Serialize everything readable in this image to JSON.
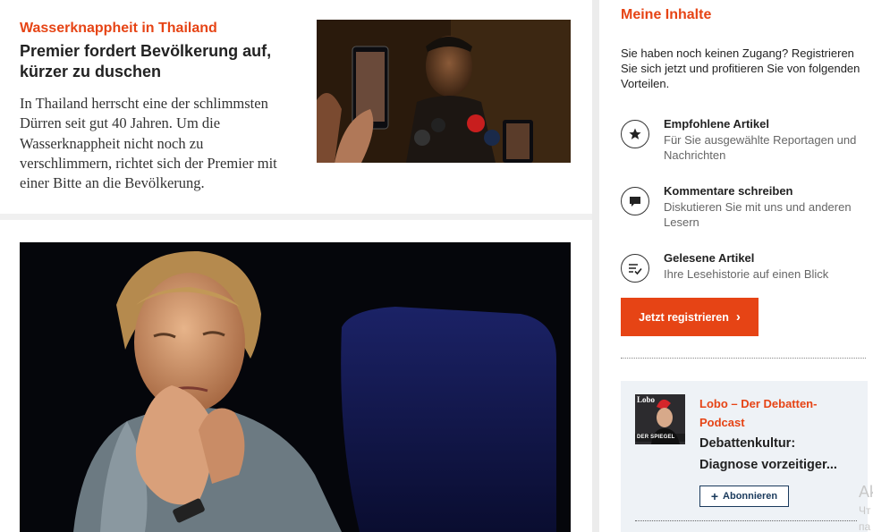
{
  "article1": {
    "kicker": "Wasserknappheit in Thailand",
    "headline": "Premier fordert Bevölkerung auf, kürzer zu duschen",
    "teaser": "In Thailand herrscht eine der schlimmsten Dürren seit gut 40 Jahren. Um die Wasserknappheit nicht noch zu verschlimmern, richtet sich der Premier mit einer Bitte an die Bevölkerung."
  },
  "sidebar": {
    "title": "Meine Inhalte",
    "intro": "Sie haben noch keinen Zugang? Registrieren Sie sich jetzt und profitieren Sie von folgenden Vorteilen.",
    "benefits": [
      {
        "icon": "star-icon",
        "title": "Empfohlene Artikel",
        "desc": "Für Sie ausgewählte Reportagen und Nachrichten"
      },
      {
        "icon": "comment-icon",
        "title": "Kommentare schreiben",
        "desc": "Diskutieren Sie mit uns und anderen Lesern"
      },
      {
        "icon": "history-icon",
        "title": "Gelesene Artikel",
        "desc": "Ihre Lesehistorie auf einen Blick"
      }
    ],
    "cta_label": "Jetzt registrieren",
    "cta_arrow": "›"
  },
  "podcast": {
    "cover_label": "Lobo",
    "cover_brand": "DER SPIEGEL",
    "series": "Lobo – Der Debatten-Podcast",
    "title_line1": "Debattenkultur:",
    "title_line2": "Diagnose vorzeitiger...",
    "subscribe_icon": "+",
    "subscribe_label": "Abonnieren"
  },
  "overlay": {
    "line1": "Ak",
    "line2": "Чт",
    "line3": "па"
  },
  "colors": {
    "accent": "#e64415",
    "navy": "#1a3a5c",
    "podcast_bg": "#eef2f6"
  }
}
